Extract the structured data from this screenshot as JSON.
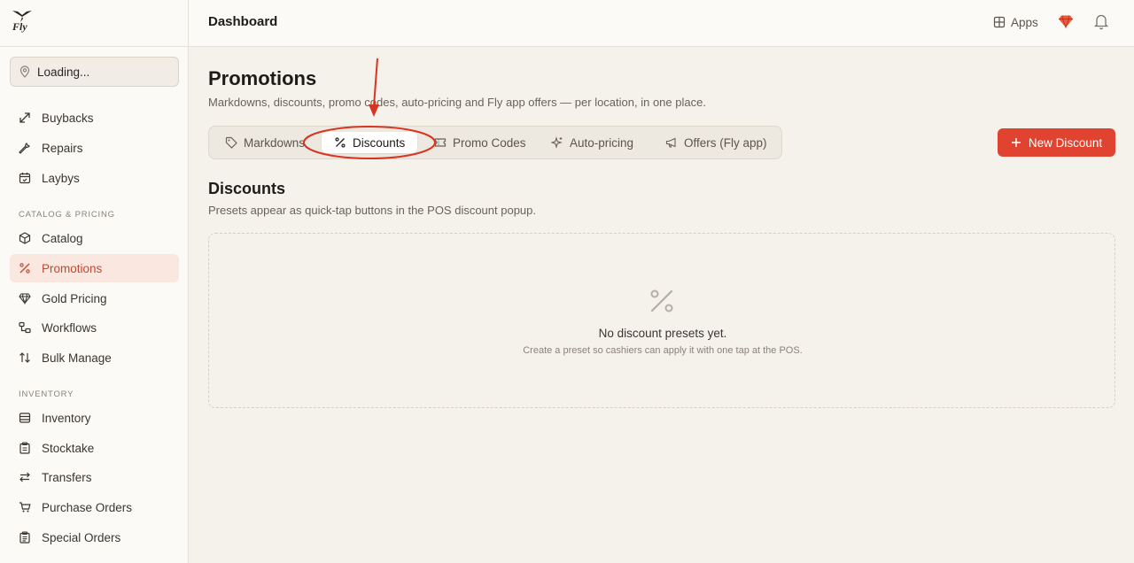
{
  "brand": {
    "name": "Fly"
  },
  "location": {
    "label": "Loading..."
  },
  "sidebar": {
    "top_items": [
      {
        "label": "Buybacks",
        "icon": "buybacks-icon"
      },
      {
        "label": "Repairs",
        "icon": "wrench-icon"
      },
      {
        "label": "Laybys",
        "icon": "calendar-icon"
      }
    ],
    "sections": [
      {
        "label": "CATALOG & PRICING",
        "items": [
          {
            "label": "Catalog",
            "icon": "box-icon"
          },
          {
            "label": "Promotions",
            "icon": "percent-icon",
            "active": true
          },
          {
            "label": "Gold Pricing",
            "icon": "gem-icon"
          },
          {
            "label": "Workflows",
            "icon": "workflow-icon"
          },
          {
            "label": "Bulk Manage",
            "icon": "arrows-updown-icon"
          }
        ]
      },
      {
        "label": "INVENTORY",
        "items": [
          {
            "label": "Inventory",
            "icon": "archive-icon"
          },
          {
            "label": "Stocktake",
            "icon": "clipboard-icon"
          },
          {
            "label": "Transfers",
            "icon": "arrows-leftright-icon"
          },
          {
            "label": "Purchase Orders",
            "icon": "cart-icon"
          },
          {
            "label": "Special Orders",
            "icon": "clipboard-list-icon"
          }
        ]
      }
    ]
  },
  "header": {
    "title": "Dashboard",
    "apps_label": "Apps"
  },
  "page": {
    "title": "Promotions",
    "subtitle": "Markdowns, discounts, promo codes, auto-pricing and Fly app offers — per location, in one place."
  },
  "tabs": [
    {
      "label": "Markdowns",
      "icon": "tag-icon"
    },
    {
      "label": "Discounts",
      "icon": "percent-icon",
      "active": true
    },
    {
      "label": "Promo Codes",
      "icon": "ticket-icon"
    },
    {
      "label": "Auto-pricing",
      "icon": "sparkles-icon"
    },
    {
      "label": "Offers (Fly app)",
      "icon": "megaphone-icon"
    }
  ],
  "new_button": {
    "label": "New Discount"
  },
  "section": {
    "title": "Discounts",
    "subtitle": "Presets appear as quick-tap buttons in the POS discount popup."
  },
  "empty_state": {
    "title": "No discount presets yet.",
    "description": "Create a preset so cashiers can apply it with one tap at the POS."
  },
  "colors": {
    "accent": "#e0432f",
    "active_nav_bg": "#fae7df",
    "active_nav_text": "#c6482d",
    "annotation": "#d9341f"
  }
}
